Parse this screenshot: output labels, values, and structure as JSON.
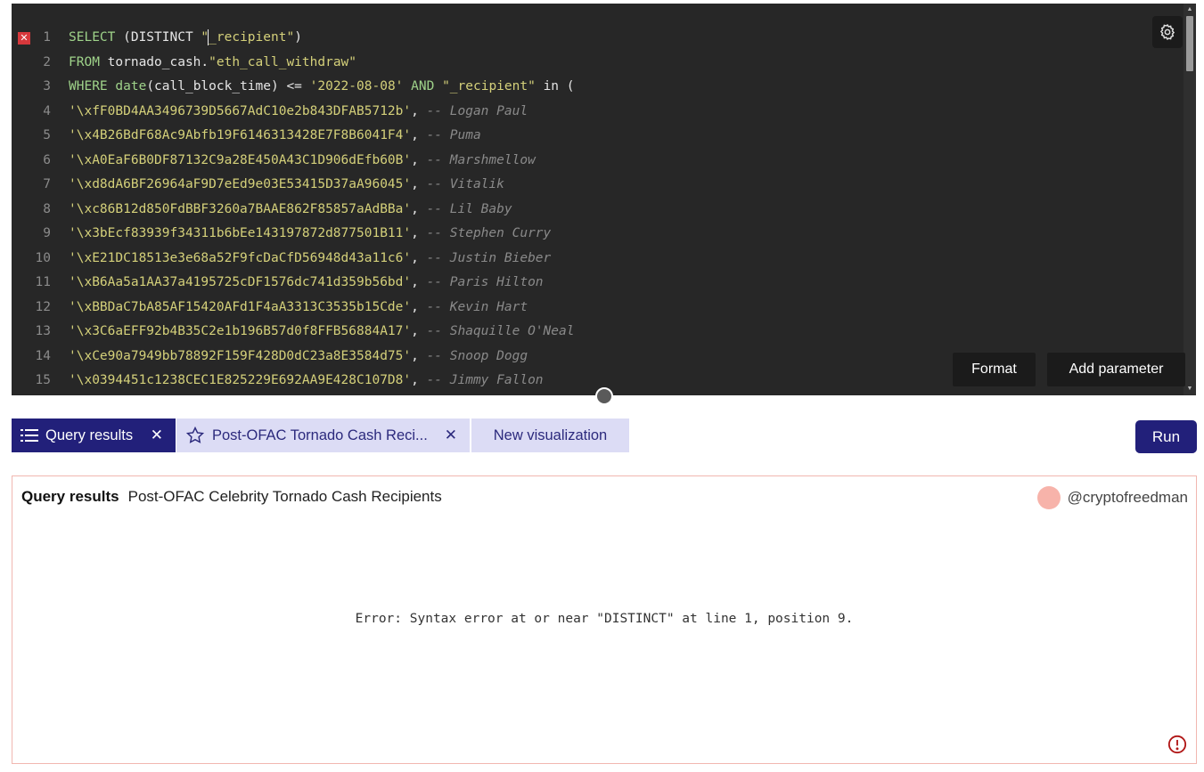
{
  "editor": {
    "error_marker": "✕",
    "lines": [
      {
        "n": "1",
        "parts": [
          [
            "k",
            "SELECT"
          ],
          [
            "plain",
            " (DISTINCT "
          ],
          [
            "str",
            "\""
          ],
          [
            "caret",
            ""
          ],
          [
            "str",
            "_recipient\""
          ],
          [
            "plain",
            ")"
          ]
        ]
      },
      {
        "n": "2",
        "parts": [
          [
            "k",
            "FROM"
          ],
          [
            "plain",
            " tornado_cash."
          ],
          [
            "str",
            "\"eth_call_withdraw\""
          ]
        ]
      },
      {
        "n": "3",
        "parts": [
          [
            "k",
            "WHERE"
          ],
          [
            "plain",
            " "
          ],
          [
            "k",
            "date"
          ],
          [
            "plain",
            "(call_block_time) <= "
          ],
          [
            "str",
            "'2022-08-08'"
          ],
          [
            "plain",
            " "
          ],
          [
            "k",
            "AND"
          ],
          [
            "plain",
            " "
          ],
          [
            "str",
            "\"_recipient\""
          ],
          [
            "plain",
            " in ("
          ]
        ]
      },
      {
        "n": "4",
        "parts": [
          [
            "str",
            "'\\xfF0BD4AA3496739D5667AdC10e2b843DFAB5712b'"
          ],
          [
            "plain",
            ", "
          ],
          [
            "cmt",
            "-- Logan Paul"
          ]
        ]
      },
      {
        "n": "5",
        "parts": [
          [
            "str",
            "'\\x4B26BdF68Ac9Abfb19F6146313428E7F8B6041F4'"
          ],
          [
            "plain",
            ", "
          ],
          [
            "cmt",
            "-- Puma"
          ]
        ]
      },
      {
        "n": "6",
        "parts": [
          [
            "str",
            "'\\xA0EaF6B0DF87132C9a28E450A43C1D906dEfb60B'"
          ],
          [
            "plain",
            ", "
          ],
          [
            "cmt",
            "-- Marshmellow"
          ]
        ]
      },
      {
        "n": "7",
        "parts": [
          [
            "str",
            "'\\xd8dA6BF26964aF9D7eEd9e03E53415D37aA96045'"
          ],
          [
            "plain",
            ", "
          ],
          [
            "cmt",
            "-- Vitalik"
          ]
        ]
      },
      {
        "n": "8",
        "parts": [
          [
            "str",
            "'\\xc86B12d850FdBBF3260a7BAAE862F85857aAdBBa'"
          ],
          [
            "plain",
            ", "
          ],
          [
            "cmt",
            "-- Lil Baby"
          ]
        ]
      },
      {
        "n": "9",
        "parts": [
          [
            "str",
            "'\\x3bEcf83939f34311b6bEe143197872d877501B11'"
          ],
          [
            "plain",
            ", "
          ],
          [
            "cmt",
            "-- Stephen Curry"
          ]
        ]
      },
      {
        "n": "10",
        "parts": [
          [
            "str",
            "'\\xE21DC18513e3e68a52F9fcDaCfD56948d43a11c6'"
          ],
          [
            "plain",
            ", "
          ],
          [
            "cmt",
            "-- Justin Bieber"
          ]
        ]
      },
      {
        "n": "11",
        "parts": [
          [
            "str",
            "'\\xB6Aa5a1AA37a4195725cDF1576dc741d359b56bd'"
          ],
          [
            "plain",
            ", "
          ],
          [
            "cmt",
            "-- Paris Hilton"
          ]
        ]
      },
      {
        "n": "12",
        "parts": [
          [
            "str",
            "'\\xBBDaC7bA85AF15420AFd1F4aA3313C3535b15Cde'"
          ],
          [
            "plain",
            ", "
          ],
          [
            "cmt",
            "-- Kevin Hart"
          ]
        ]
      },
      {
        "n": "13",
        "parts": [
          [
            "str",
            "'\\x3C6aEFF92b4B35C2e1b196B57d0f8FFB56884A17'"
          ],
          [
            "plain",
            ", "
          ],
          [
            "cmt",
            "-- Shaquille O'Neal"
          ]
        ]
      },
      {
        "n": "14",
        "parts": [
          [
            "str",
            "'\\xCe90a7949bb78892F159F428D0dC23a8E3584d75'"
          ],
          [
            "plain",
            ", "
          ],
          [
            "cmt",
            "-- Snoop Dogg"
          ]
        ]
      },
      {
        "n": "15",
        "parts": [
          [
            "str",
            "'\\x0394451c1238CEC1E825229E692AA9E428C107D8'"
          ],
          [
            "plain",
            ", "
          ],
          [
            "cmt",
            "-- Jimmy Fallon"
          ]
        ]
      }
    ],
    "format_label": "Format",
    "add_parameter_label": "Add parameter"
  },
  "tabs": {
    "results_label": "Query results",
    "viz_label": "Post-OFAC Tornado Cash Reci...",
    "new_viz_label": "New visualization",
    "close_glyph": "✕"
  },
  "run_label": "Run",
  "results": {
    "heading": "Query results",
    "title": "Post-OFAC Celebrity Tornado Cash Recipients",
    "author": "@cryptofreedman",
    "error": "Error: Syntax error at or near \"DISTINCT\" at line 1, position 9."
  },
  "colors": {
    "editor_bg": "#272727",
    "accent": "#22207a",
    "tab_inactive": "#dcdcf5",
    "error_red": "#b01515"
  }
}
